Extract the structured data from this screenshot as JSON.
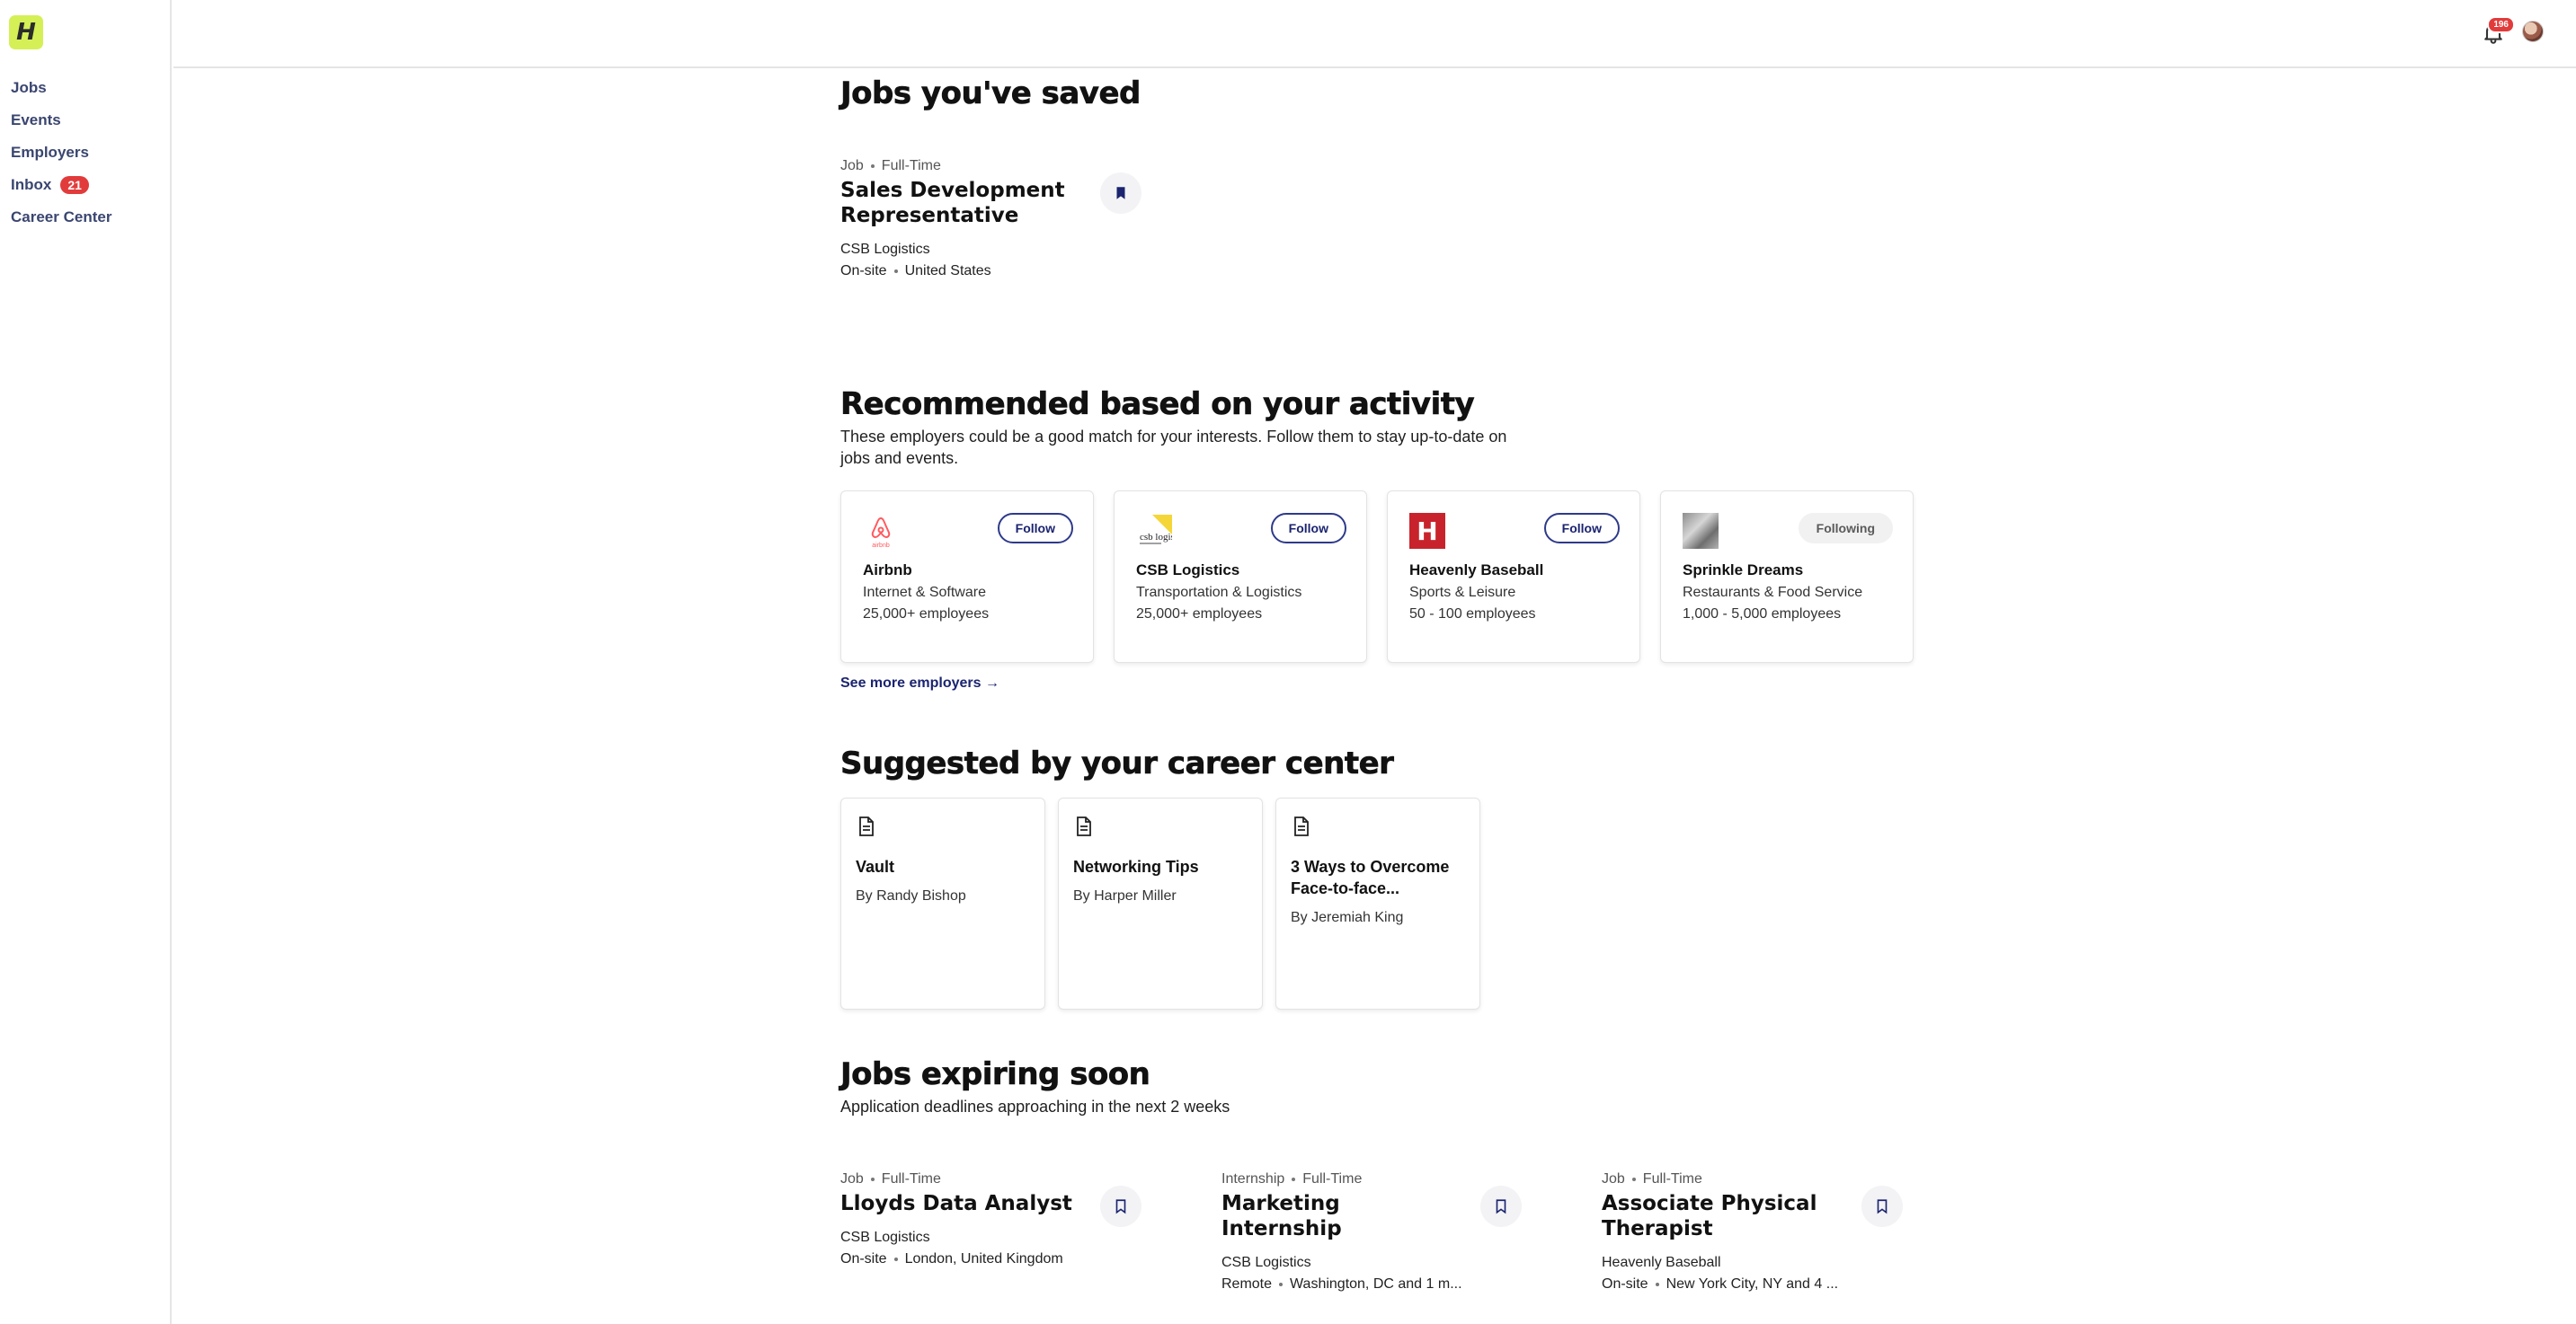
{
  "sidebar": {
    "logo": "H",
    "items": [
      {
        "label": "Jobs"
      },
      {
        "label": "Events"
      },
      {
        "label": "Employers"
      },
      {
        "label": "Inbox",
        "badge": "21"
      },
      {
        "label": "Career Center"
      }
    ]
  },
  "header": {
    "notification_count": "196",
    "icons": [
      "bell-icon",
      "avatar"
    ]
  },
  "saved": {
    "title": "Jobs you've saved",
    "jobs": [
      {
        "type": "Job",
        "schedule": "Full-Time",
        "title": "Sales Development Representative",
        "company": "CSB Logistics",
        "workplace": "On-site",
        "location": "United States",
        "saved": true
      }
    ]
  },
  "recommended": {
    "title": "Recommended based on your activity",
    "description": "These employers could be a good match for your interests. Follow them to stay up-to-date on jobs and events.",
    "employers": [
      {
        "name": "Airbnb",
        "industry": "Internet & Software",
        "size": "25,000+ employees",
        "button": "Follow",
        "logo_text": "airbnb"
      },
      {
        "name": "CSB Logistics",
        "industry": "Transportation & Logistics",
        "size": "25,000+ employees",
        "button": "Follow",
        "logo_text": "csb logistics"
      },
      {
        "name": "Heavenly Baseball",
        "industry": "Sports & Leisure",
        "size": "50 - 100 employees",
        "button": "Follow",
        "logo_text": "H"
      },
      {
        "name": "Sprinkle Dreams",
        "industry": "Restaurants & Food Service",
        "size": "1,000 - 5,000 employees",
        "button": "Following"
      }
    ],
    "see_more": "See more employers →"
  },
  "suggested": {
    "title": "Suggested by your career center",
    "resources": [
      {
        "title": "Vault",
        "author": "By Randy Bishop"
      },
      {
        "title": "Networking Tips",
        "author": "By Harper Miller"
      },
      {
        "title": "3 Ways to Overcome Face-to-face...",
        "author": "By Jeremiah King"
      }
    ]
  },
  "expiring": {
    "title": "Jobs expiring soon",
    "description": "Application deadlines approaching in the next 2 weeks",
    "jobs": [
      {
        "type": "Job",
        "schedule": "Full-Time",
        "title": "Lloyds Data Analyst",
        "company": "CSB Logistics",
        "workplace": "On-site",
        "location": "London, United Kingdom"
      },
      {
        "type": "Internship",
        "schedule": "Full-Time",
        "title": "Marketing Internship",
        "company": "CSB Logistics",
        "workplace": "Remote",
        "location": "Washington, DC and 1 m..."
      },
      {
        "type": "Job",
        "schedule": "Full-Time",
        "title": "Associate Physical Therapist",
        "company": "Heavenly Baseball",
        "workplace": "On-site",
        "location": "New York City, NY and 4 ..."
      }
    ]
  },
  "colors": {
    "accent": "#1b2470",
    "logo_bg": "#d4f056",
    "badge": "#e23b3b"
  }
}
